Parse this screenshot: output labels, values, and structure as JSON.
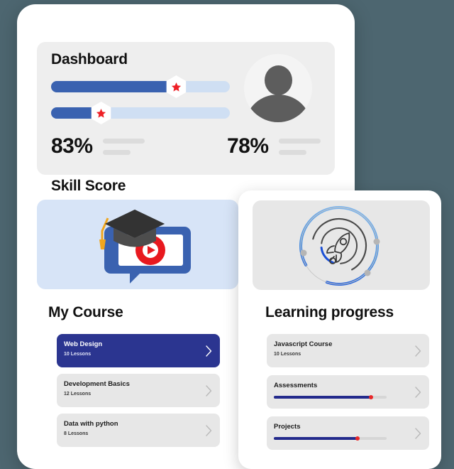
{
  "colors": {
    "background": "#4d6670",
    "panel": "#ffffff",
    "card_gray": "#eeeeee",
    "card_blue": "#d7e4f7",
    "accent_navy": "#2b3590",
    "slider_fill": "#3a62b0",
    "slider_track": "#cfdff3",
    "progress_fill": "#232a8c",
    "progress_dot": "#e8282a",
    "star_red": "#ee2026"
  },
  "dashboard": {
    "title": "Dashboard",
    "sliders": [
      {
        "name": "slider-one",
        "value": 70,
        "handle_icon": "star-icon"
      },
      {
        "name": "slider-two",
        "value": 28,
        "handle_icon": "star-icon"
      }
    ],
    "stats": [
      {
        "value": "83%"
      },
      {
        "value": "78%"
      }
    ],
    "avatar_icon": "user-avatar-icon"
  },
  "skill_score": {
    "title": "Skill Score",
    "left_illustration": "video-lesson-graduation-cap-icon",
    "right_illustration": "rocket-progress-rings-icon"
  },
  "my_course": {
    "title": "My Course",
    "items": [
      {
        "name": "Web Design",
        "lessons": "10 Lessons",
        "active": true
      },
      {
        "name": "Development Basics",
        "lessons": "12 Lessons",
        "active": false
      },
      {
        "name": "Data with python",
        "lessons": "8 Lessons",
        "active": false
      }
    ]
  },
  "learning_progress": {
    "title": "Learning progress",
    "items": [
      {
        "name": "Javascript Course",
        "lessons": "10 Lessons",
        "progress": null
      },
      {
        "name": "Assessments",
        "lessons": null,
        "progress": 86
      },
      {
        "name": "Projects",
        "lessons": null,
        "progress": 74
      }
    ]
  },
  "icons": {
    "chevron_right": "chevron-right-icon"
  }
}
